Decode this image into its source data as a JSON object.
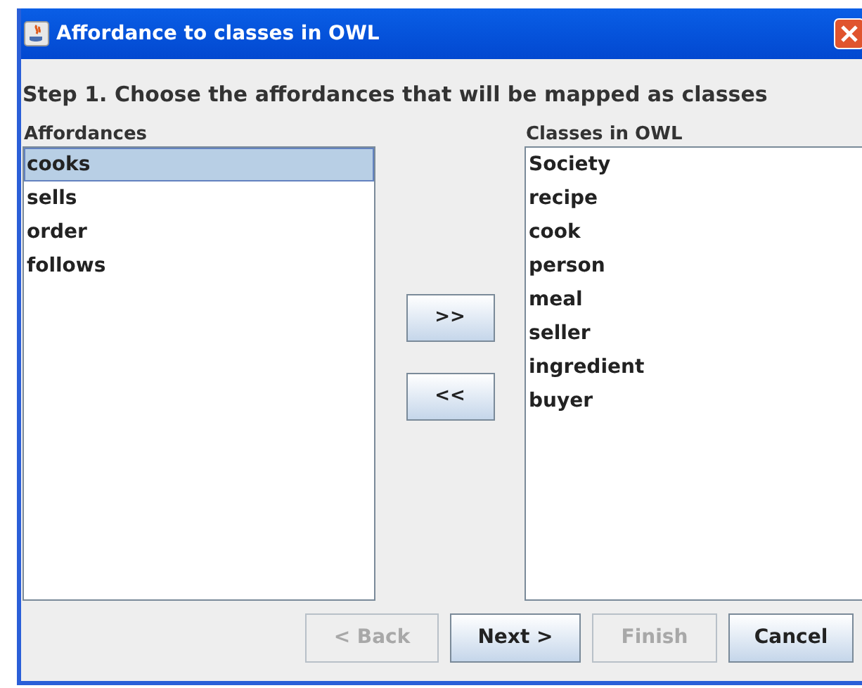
{
  "window": {
    "title": "Affordance to classes in OWL"
  },
  "step": "Step 1. Choose the affordances that will be mapped as classes",
  "affordances": {
    "label": "Affordances",
    "items": [
      {
        "text": "cooks",
        "selected": true
      },
      {
        "text": "sells",
        "selected": false
      },
      {
        "text": "order",
        "selected": false
      },
      {
        "text": "follows",
        "selected": false
      }
    ]
  },
  "transfer_buttons": [
    ">>",
    "<<"
  ],
  "classes": {
    "label": "Classes in OWL",
    "items": [
      {
        "text": "Society",
        "selected": false
      },
      {
        "text": "recipe",
        "selected": false
      },
      {
        "text": "cook",
        "selected": false
      },
      {
        "text": "person",
        "selected": false
      },
      {
        "text": "meal",
        "selected": false
      },
      {
        "text": "seller",
        "selected": false
      },
      {
        "text": "ingredient",
        "selected": false
      },
      {
        "text": "buyer",
        "selected": false
      }
    ]
  },
  "buttons": [
    {
      "label": "< Back",
      "disabled": true
    },
    {
      "label": "Next >",
      "disabled": false
    },
    {
      "label": "Finish",
      "disabled": true
    },
    {
      "label": "Cancel",
      "disabled": false
    }
  ]
}
